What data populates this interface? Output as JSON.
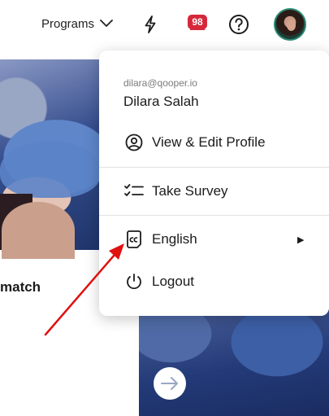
{
  "header": {
    "programs_label": "Programs",
    "notification_count": "98",
    "icons": {
      "programs_caret": "chevron-down-icon",
      "activity": "bolt-icon",
      "inbox": "inbox-icon",
      "help": "help-icon"
    }
  },
  "user": {
    "email": "dilara@qooper.io",
    "name": "Dilara Salah"
  },
  "menu": {
    "items": [
      {
        "label": "View & Edit Profile",
        "icon": "user-circle-icon"
      },
      {
        "label": "Take Survey",
        "icon": "checklist-icon"
      },
      {
        "label": "English",
        "icon": "caption-icon",
        "has_submenu": true
      },
      {
        "label": "Logout",
        "icon": "power-icon"
      }
    ]
  },
  "background": {
    "card_title_fragment": "match"
  },
  "colors": {
    "badge": "#d6283b",
    "avatar_ring": "#2a8a75",
    "annotation_arrow": "#e01010"
  }
}
